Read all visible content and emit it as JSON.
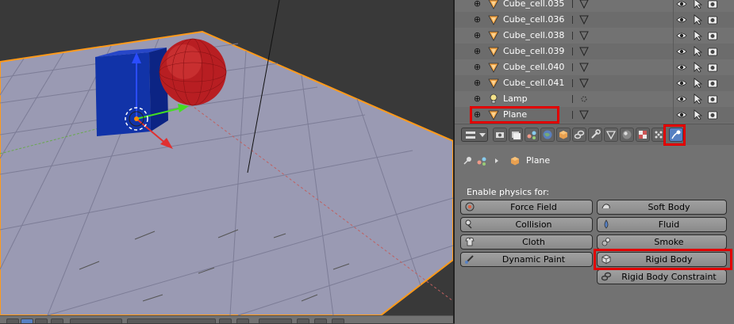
{
  "outliner": {
    "items": [
      {
        "name": "Cube_cell.035",
        "type": "mesh"
      },
      {
        "name": "Cube_cell.036",
        "type": "mesh"
      },
      {
        "name": "Cube_cell.038",
        "type": "mesh"
      },
      {
        "name": "Cube_cell.039",
        "type": "mesh"
      },
      {
        "name": "Cube_cell.040",
        "type": "mesh"
      },
      {
        "name": "Cube_cell.041",
        "type": "mesh"
      },
      {
        "name": "Lamp",
        "type": "lamp"
      },
      {
        "name": "Plane",
        "type": "mesh"
      }
    ]
  },
  "properties": {
    "active_tab": "physics",
    "context_object": "Plane",
    "enable_label": "Enable physics for:",
    "buttons_left": [
      "Force Field",
      "Collision",
      "Cloth",
      "Dynamic Paint"
    ],
    "buttons_right": [
      "Soft Body",
      "Fluid",
      "Smoke",
      "Rigid Body",
      "Rigid Body Constraint"
    ]
  },
  "colors": {
    "highlight": "#e00000",
    "active_tab": "#5680c2",
    "panel_bg": "#727272",
    "viewport_floor": "#9a9ab3",
    "cube": "#1133a8",
    "sphere": "#b81e22",
    "selection_outline": "#ff9a1a"
  },
  "icons": {
    "row_expand": "plus-icon",
    "mesh": "mesh-triangle-icon",
    "lamp": "lamp-icon",
    "visibility": "eye-icon",
    "selectability": "cursor-icon",
    "renderability": "camera-icon"
  }
}
